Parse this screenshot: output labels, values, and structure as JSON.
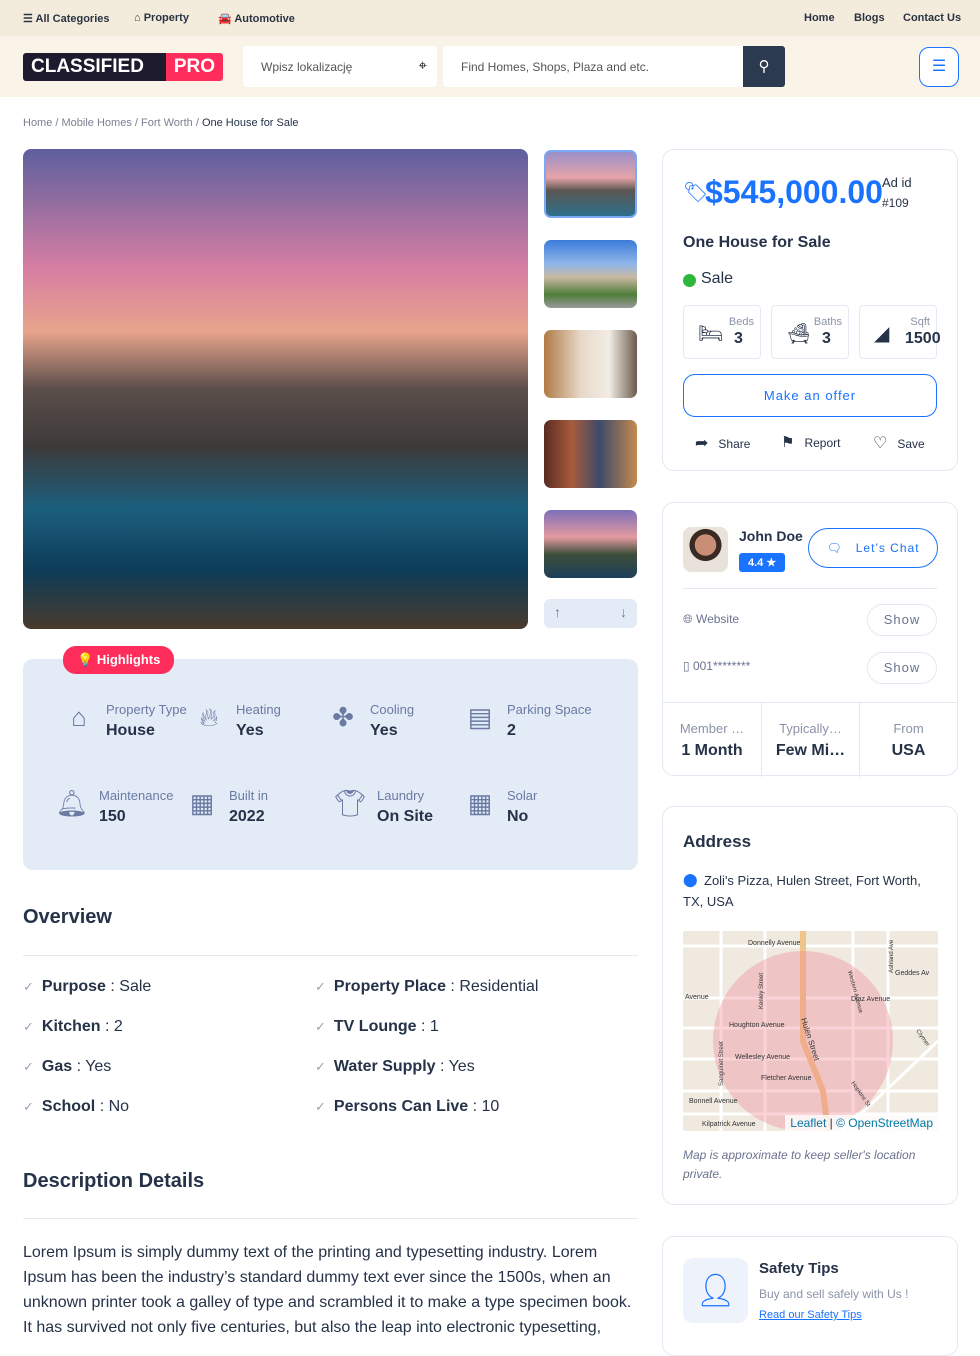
{
  "topbar": {
    "left": [
      {
        "icon": "menu-icon",
        "label": "All Categories"
      },
      {
        "icon": "home-icon",
        "label": "Property"
      },
      {
        "icon": "car-icon",
        "label": "Automotive"
      }
    ],
    "right": [
      "Home",
      "Blogs",
      "Contact Us"
    ]
  },
  "header": {
    "logo": "CLASSIFIED PRO",
    "location_placeholder": "Wpisz lokalizację",
    "search_placeholder": "Find Homes, Shops, Plaza and etc."
  },
  "breadcrumb": [
    "Home",
    "Mobile Homes",
    "Fort Worth",
    "One House for Sale"
  ],
  "highlights": {
    "badge": "Highlights",
    "items": [
      {
        "icon": "house-icon",
        "label": "Property Type",
        "value": "House"
      },
      {
        "icon": "fire-icon",
        "label": "Heating",
        "value": "Yes"
      },
      {
        "icon": "fan-icon",
        "label": "Cooling",
        "value": "Yes"
      },
      {
        "icon": "garage-icon",
        "label": "Parking Space",
        "value": "2"
      },
      {
        "icon": "bell-icon",
        "label": "Maintenance",
        "value": "150"
      },
      {
        "icon": "building-icon",
        "label": "Built in",
        "value": "2022"
      },
      {
        "icon": "shirt-icon",
        "label": "Laundry",
        "value": "On Site"
      },
      {
        "icon": "solar-panel-icon",
        "label": "Solar",
        "value": "No"
      }
    ]
  },
  "overview": {
    "title": "Overview",
    "items": [
      {
        "k": "Purpose",
        "v": "Sale"
      },
      {
        "k": "Property Place",
        "v": "Residential"
      },
      {
        "k": "Kitchen",
        "v": "2"
      },
      {
        "k": "TV Lounge",
        "v": "1"
      },
      {
        "k": "Gas",
        "v": "Yes"
      },
      {
        "k": "Water Supply",
        "v": "Yes"
      },
      {
        "k": "School",
        "v": "No"
      },
      {
        "k": "Persons Can Live",
        "v": "10"
      }
    ]
  },
  "description": {
    "title": "Description Details",
    "text": "Lorem Ipsum is simply dummy text of the printing and typesetting industry. Lorem Ipsum has been the industry’s standard dummy text ever since the 1500s, when an unknown printer took a galley of type and scrambled it to make a type specimen book. It has survived not only five centuries, but also the leap into electronic typesetting,"
  },
  "listing": {
    "price": "$545,000.00",
    "ad_id_label": "Ad id",
    "ad_id": "#109",
    "title": "One House for Sale",
    "status": "Sale",
    "status_color": "#2db83d",
    "stats": [
      {
        "label": "Beds",
        "value": "3"
      },
      {
        "label": "Baths",
        "value": "3"
      },
      {
        "label": "Sqft",
        "value": "1500"
      }
    ],
    "offer": "Make an offer",
    "actions": [
      "Share",
      "Report",
      "Save"
    ]
  },
  "seller": {
    "name": "John Doe",
    "rating": "4.4",
    "chat": "Let’s Chat",
    "website": "Website",
    "phone": "001********",
    "show": "Show",
    "stats": [
      {
        "label": "Member …",
        "value": "1 Month"
      },
      {
        "label": "Typically…",
        "value": "Few Mi…"
      },
      {
        "label": "From",
        "value": "USA"
      }
    ]
  },
  "address": {
    "title": "Address",
    "text": "Zoli's Pizza, Hulen Street, Fort Worth, TX, USA",
    "map_labels": [
      "Donnelly Avenue",
      "Geddes Av",
      "Diaz Avenue",
      "Avenue",
      "Houghton Avenue",
      "Wellesley Avenue",
      "Fletcher Avenue",
      "Bonnell Avenue",
      "Kilpatrick Avenue",
      "Hulen Street",
      "Kenley Street",
      "Sanguinet Street",
      "Western Avenue",
      "Ashland Ave",
      "Clymer",
      "Hopkins St"
    ],
    "attribution_leaflet": "Leaflet",
    "attribution_osm": "© OpenStreetMap",
    "note": "Map is approximate to keep seller's location private."
  },
  "safety": {
    "title": "Safety Tips",
    "text": "Buy and sell safely with Us !",
    "link": "Read our Safety Tips"
  },
  "colors": {
    "accent": "#1a73ff",
    "brand": "#ff2d5b",
    "dark": "#2b3a4f"
  }
}
